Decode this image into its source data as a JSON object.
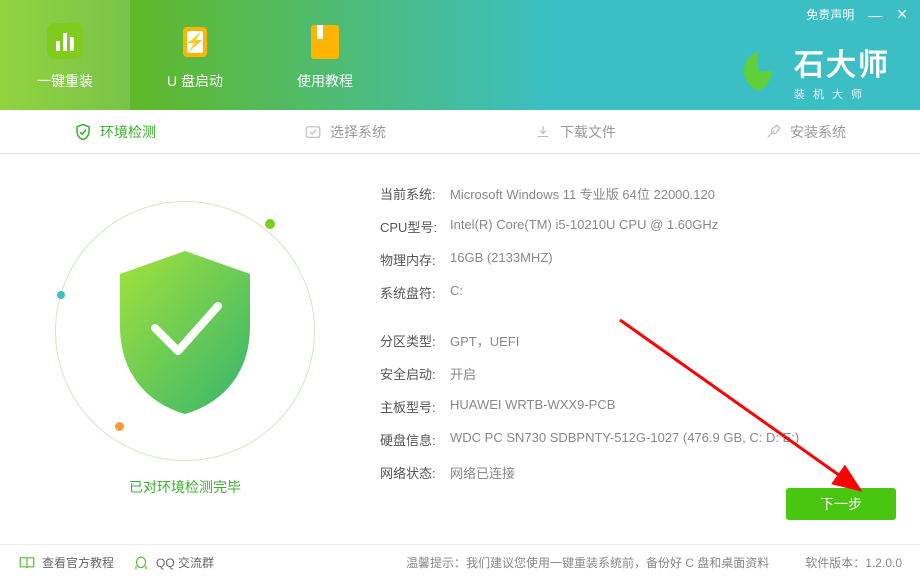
{
  "topbar": {
    "disclaimer": "免责声明",
    "minimize": "—",
    "close": "✕"
  },
  "brand": {
    "title": "石大师",
    "subtitle": "装机大师"
  },
  "nav": {
    "reinstall": "一键重装",
    "usb": "U 盘启动",
    "tutorial": "使用教程"
  },
  "steps": {
    "env": "环境检测",
    "select": "选择系统",
    "download": "下载文件",
    "install": "安装系统"
  },
  "status": "已对环境检测完毕",
  "info": {
    "os_label": "当前系统:",
    "os_value": "Microsoft Windows 11 专业版 64位 22000.120",
    "cpu_label": "CPU型号:",
    "cpu_value": "Intel(R) Core(TM) i5-10210U CPU @ 1.60GHz",
    "ram_label": "物理内存:",
    "ram_value": "16GB (2133MHZ)",
    "drive_label": "系统盘符:",
    "drive_value": "C:",
    "part_label": "分区类型:",
    "part_value": "GPT，UEFI",
    "secure_label": "安全启动:",
    "secure_value": "开启",
    "mb_label": "主板型号:",
    "mb_value": "HUAWEI WRTB-WXX9-PCB",
    "disk_label": "硬盘信息:",
    "disk_value": "WDC PC SN730 SDBPNTY-512G-1027  (476.9 GB, C: D: E:)",
    "net_label": "网络状态:",
    "net_value": "网络已连接"
  },
  "next": "下一步",
  "footer": {
    "official": "查看官方教程",
    "qq": "QQ 交流群",
    "tip": "温馨提示：我们建议您使用一键重装系统前，备份好 C 盘和桌面资料",
    "version_label": "软件版本：",
    "version": "1.2.0.0"
  }
}
